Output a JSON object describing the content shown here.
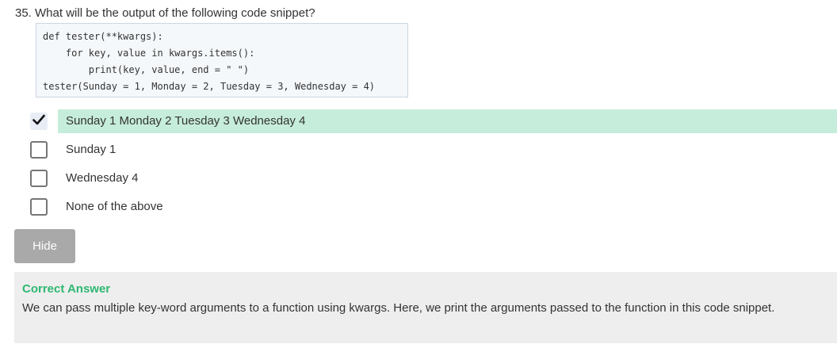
{
  "question": {
    "text": "35. What will be the output of the following code snippet?"
  },
  "code": {
    "lines": [
      "def tester(**kwargs):",
      "    for key, value in kwargs.items():",
      "        print(key, value, end = \" \")",
      "tester(Sunday = 1, Monday = 2, Tuesday = 3, Wednesday = 4)"
    ]
  },
  "options": [
    {
      "label": "Sunday 1 Monday 2 Tuesday 3 Wednesday 4",
      "checked": true,
      "correct": true
    },
    {
      "label": "Sunday 1",
      "checked": false,
      "correct": false
    },
    {
      "label": "Wednesday 4",
      "checked": false,
      "correct": false
    },
    {
      "label": "None of the above",
      "checked": false,
      "correct": false
    }
  ],
  "hide_button": {
    "label": "Hide"
  },
  "answer": {
    "title": "Correct Answer",
    "explanation": "We can pass multiple key-word arguments to a function using kwargs. Here, we print the arguments passed to the function in this code snippet."
  },
  "colors": {
    "correct_highlight": "#c6eddb",
    "correct_title": "#2eb872",
    "button_bg": "#a9a9a9",
    "answer_bg": "#eeeeee"
  }
}
